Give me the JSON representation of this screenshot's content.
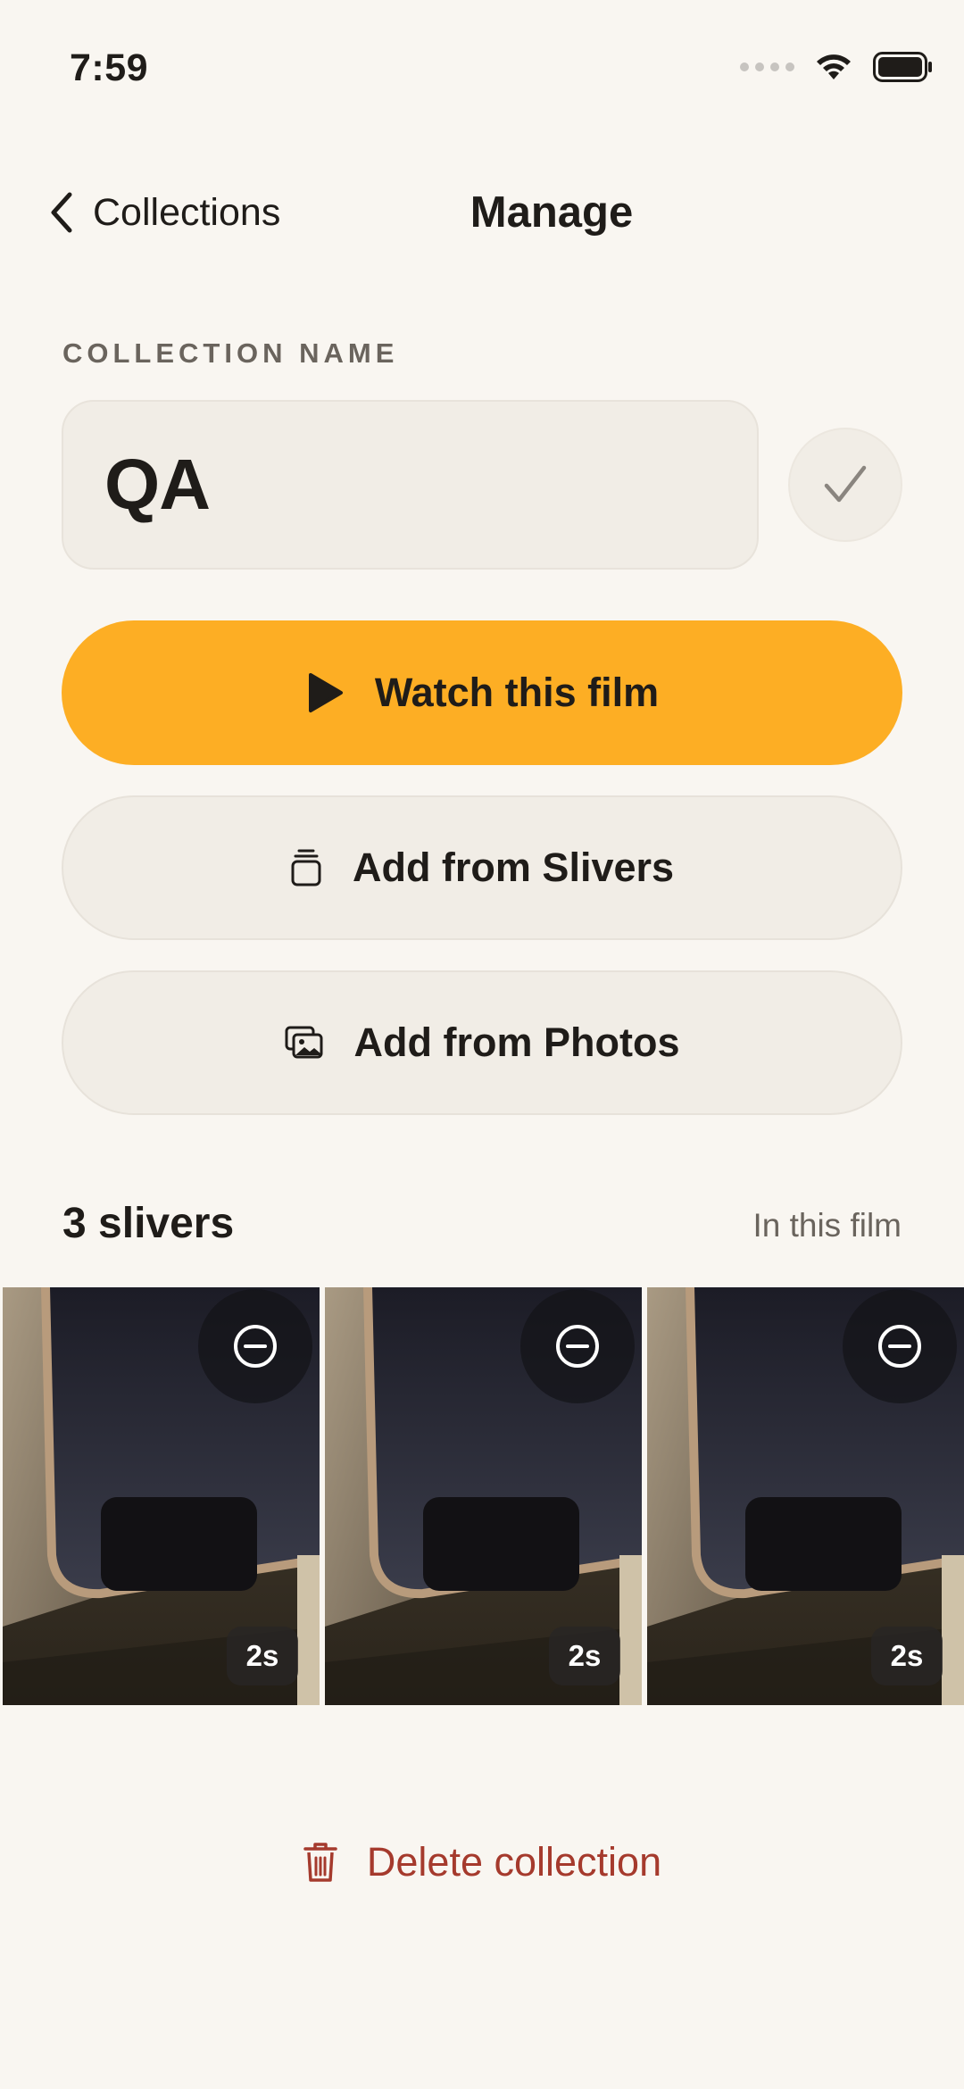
{
  "status_bar": {
    "time": "7:59"
  },
  "nav": {
    "back_label": "Collections",
    "title": "Manage"
  },
  "collection": {
    "section_label": "COLLECTION NAME",
    "name_value": "QA"
  },
  "actions": {
    "watch_label": "Watch this film",
    "add_slivers_label": "Add from Slivers",
    "add_photos_label": "Add from Photos"
  },
  "slivers": {
    "count_label": "3 slivers",
    "subtitle": "In this film",
    "items": [
      {
        "duration": "2s"
      },
      {
        "duration": "2s"
      },
      {
        "duration": "2s"
      }
    ]
  },
  "delete": {
    "label": "Delete collection"
  },
  "colors": {
    "background": "#f9f6f1",
    "accent": "#fdae24",
    "destructive": "#a53a2d",
    "field": "#f1ede6"
  },
  "icons": {
    "back": "chevron-left-icon",
    "confirm": "checkmark-icon",
    "watch": "play-icon",
    "slivers": "stack-icon",
    "photos": "photos-icon",
    "remove": "minus-circle-icon",
    "delete": "trash-icon"
  }
}
